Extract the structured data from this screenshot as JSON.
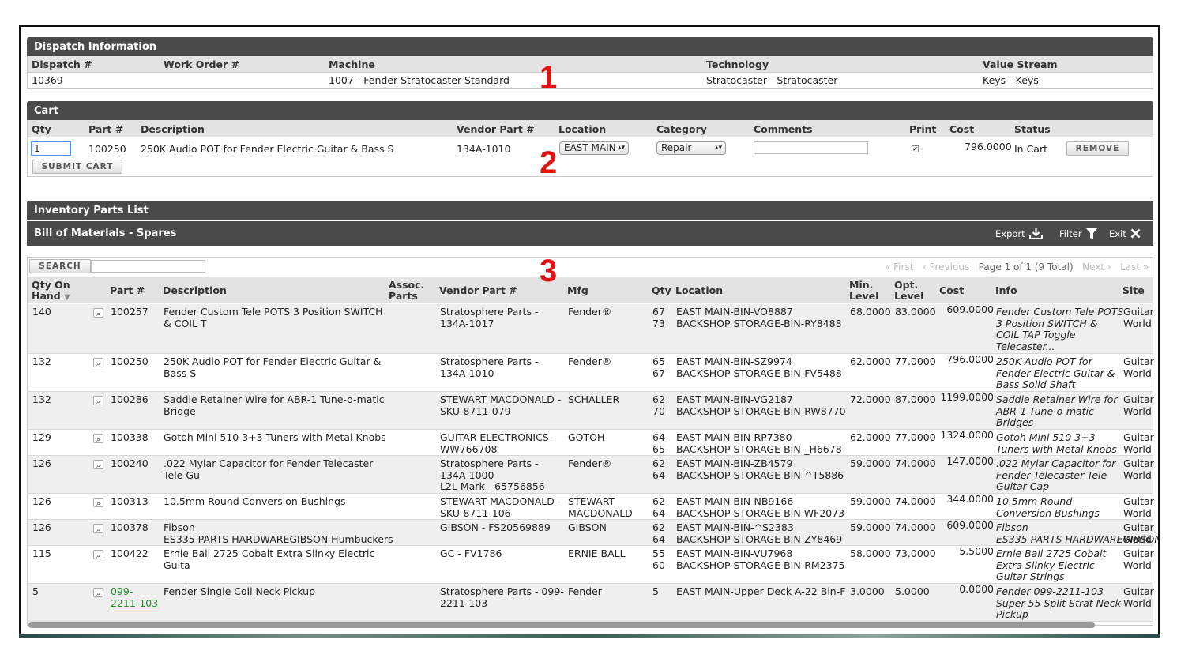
{
  "dispatch": {
    "title": "Dispatch Information",
    "headers": [
      "Dispatch #",
      "Work Order #",
      "Machine",
      "Technology",
      "Value Stream"
    ],
    "values": [
      "10369",
      "",
      "1007 - Fender Stratocaster Standard",
      "Stratocaster - Stratocaster",
      "Keys - Keys"
    ]
  },
  "cart": {
    "title": "Cart",
    "headers": [
      "Qty",
      "Part #",
      "Description",
      "Vendor Part #",
      "Location",
      "Category",
      "Comments",
      "Print",
      "Cost",
      "Status"
    ],
    "row": {
      "qty": "1",
      "part": "100250",
      "description": "250K Audio POT for Fender Electric Guitar & Bass S",
      "vendor_part": "134A-1010",
      "location": "EAST MAIN",
      "category": "Repair",
      "comments": "",
      "print_checked": true,
      "cost": "796.0000",
      "status": "In Cart",
      "remove_label": "REMOVE"
    },
    "submit_label": "SUBMIT CART"
  },
  "inventory": {
    "title": "Inventory Parts List",
    "subtitle": "Bill of Materials - Spares",
    "toolbar": {
      "export": "Export",
      "filter": "Filter",
      "exit": "Exit"
    },
    "search_label": "SEARCH",
    "search_value": "",
    "pager": {
      "first": "« First",
      "previous": "‹ Previous",
      "page": "Page 1 of 1 (9 Total)",
      "next": "Next ›",
      "last": "Last »"
    },
    "columns": [
      "Qty On Hand",
      "Part #",
      "Description",
      "Assoc. Parts",
      "Vendor Part #",
      "Mfg",
      "Qty",
      "Location",
      "Min. Level",
      "Opt. Level",
      "Cost",
      "Info",
      "Site"
    ],
    "rows": [
      {
        "qoh": "140",
        "part": [
          "100257"
        ],
        "desc": [
          "Fender Custom Tele POTS 3 Position SWITCH",
          "& COIL T"
        ],
        "vendor": [
          "Stratosphere Parts -",
          "134A-1017"
        ],
        "mfg": [
          "Fender®"
        ],
        "qty": [
          "67",
          "73"
        ],
        "loc": [
          "EAST MAIN-BIN-VO8887",
          "BACKSHOP STORAGE-BIN-RY8488"
        ],
        "min": "68.0000",
        "opt": "83.0000",
        "cost": "609.0000",
        "info": [
          "Fender Custom Tele POTS",
          "3 Position SWITCH &",
          "COIL TAP Toggle",
          "Telecaster..."
        ],
        "site": [
          "Guitar",
          "World"
        ]
      },
      {
        "qoh": "132",
        "part": [
          "100250"
        ],
        "desc": [
          "250K Audio POT for Fender Electric Guitar &",
          "Bass S"
        ],
        "vendor": [
          "Stratosphere Parts -",
          "134A-1010"
        ],
        "mfg": [
          "Fender®"
        ],
        "qty": [
          "65",
          "67"
        ],
        "loc": [
          "EAST MAIN-BIN-SZ9974",
          "BACKSHOP STORAGE-BIN-FV5488"
        ],
        "min": "62.0000",
        "opt": "77.0000",
        "cost": "796.0000",
        "info": [
          "250K Audio POT for",
          "Fender Electric Guitar &",
          "Bass Solid Shaft"
        ],
        "site": [
          "Guitar",
          "World"
        ]
      },
      {
        "qoh": "132",
        "part": [
          "100286"
        ],
        "desc": [
          "Saddle Retainer Wire for ABR-1 Tune-o-matic",
          "Bridge"
        ],
        "vendor": [
          "STEWART MACDONALD -",
          "SKU-8711-079"
        ],
        "mfg": [
          "SCHALLER"
        ],
        "qty": [
          "62",
          "70"
        ],
        "loc": [
          "EAST MAIN-BIN-VG2187",
          "BACKSHOP STORAGE-BIN-RW8770"
        ],
        "min": "72.0000",
        "opt": "87.0000",
        "cost": "1199.0000",
        "info": [
          "Saddle Retainer Wire for",
          "ABR-1 Tune-o-matic",
          "Bridges"
        ],
        "site": [
          "Guitar",
          "World"
        ]
      },
      {
        "qoh": "129",
        "part": [
          "100338"
        ],
        "desc": [
          "Gotoh Mini 510 3+3 Tuners with Metal Knobs"
        ],
        "vendor": [
          "GUITAR ELECTRONICS -",
          "WW766708"
        ],
        "mfg": [
          "GOTOH"
        ],
        "qty": [
          "64",
          "65"
        ],
        "loc": [
          "EAST MAIN-BIN-RP7380",
          "BACKSHOP STORAGE-BIN-_H6678"
        ],
        "min": "62.0000",
        "opt": "77.0000",
        "cost": "1324.0000",
        "info": [
          "Gotoh Mini 510 3+3",
          "Tuners with Metal Knobs"
        ],
        "site": [
          "Guitar",
          "World"
        ]
      },
      {
        "qoh": "126",
        "part": [
          "100240"
        ],
        "desc": [
          ".022 Mylar Capacitor for Fender Telecaster",
          "Tele Gu"
        ],
        "vendor": [
          "Stratosphere Parts -",
          "134A-1000",
          "L2L Mark - 65756856"
        ],
        "mfg": [
          "Fender®"
        ],
        "qty": [
          "62",
          "64"
        ],
        "loc": [
          "EAST MAIN-BIN-ZB4579",
          "BACKSHOP STORAGE-BIN-^T5886"
        ],
        "min": "59.0000",
        "opt": "74.0000",
        "cost": "147.0000",
        "info": [
          ".022 Mylar Capacitor for",
          "Fender Telecaster Tele",
          "Guitar Cap"
        ],
        "site": [
          "Guitar",
          "World"
        ]
      },
      {
        "qoh": "126",
        "part": [
          "100313"
        ],
        "desc": [
          "10.5mm Round Conversion Bushings"
        ],
        "vendor": [
          "STEWART MACDONALD -",
          "SKU-8711-106"
        ],
        "mfg": [
          "STEWART",
          "MACDONALD"
        ],
        "qty": [
          "62",
          "64"
        ],
        "loc": [
          "EAST MAIN-BIN-NB9166",
          "BACKSHOP STORAGE-BIN-WF2073"
        ],
        "min": "59.0000",
        "opt": "74.0000",
        "cost": "344.0000",
        "info": [
          "10.5mm Round",
          "Conversion Bushings"
        ],
        "site": [
          "Guitar",
          "World"
        ]
      },
      {
        "qoh": "126",
        "part": [
          "100378"
        ],
        "desc": [
          "Fibson",
          "ES335 PARTS HARDWAREGIBSON Humbuckers"
        ],
        "vendor": [
          "GIBSON - FS20569889"
        ],
        "mfg": [
          "GIBSON"
        ],
        "qty": [
          "62",
          "64"
        ],
        "loc": [
          "EAST MAIN-BIN-^S2383",
          "BACKSHOP STORAGE-BIN-ZY8469"
        ],
        "min": "59.0000",
        "opt": "74.0000",
        "cost": "609.0000",
        "info": [
          "Fibson",
          "ES335 PARTS HARDWAREGIBSON"
        ],
        "site": [
          "Guitar",
          "World"
        ]
      },
      {
        "qoh": "115",
        "part": [
          "100422"
        ],
        "desc": [
          "Ernie Ball 2725 Cobalt Extra Slinky Electric",
          "Guita"
        ],
        "vendor": [
          "GC - FV1786"
        ],
        "mfg": [
          "ERNIE BALL"
        ],
        "qty": [
          "55",
          "60"
        ],
        "loc": [
          "EAST MAIN-BIN-VU7968",
          "BACKSHOP STORAGE-BIN-RM2375"
        ],
        "min": "58.0000",
        "opt": "73.0000",
        "cost": "5.5000",
        "info": [
          "Ernie Ball 2725 Cobalt",
          "Extra Slinky Electric",
          "Guitar Strings"
        ],
        "site": [
          "Guitar",
          "World"
        ]
      },
      {
        "qoh": "5",
        "part": [
          "099-",
          "2211-103"
        ],
        "part_link": true,
        "desc": [
          "Fender Single Coil Neck Pickup"
        ],
        "vendor": [
          "Stratosphere Parts - 099-",
          "2211-103"
        ],
        "mfg": [
          "Fender"
        ],
        "qty": [
          "5"
        ],
        "loc": [
          "EAST MAIN-Upper Deck A-22 Bin-F"
        ],
        "min": "3.0000",
        "opt": "5.0000",
        "cost": "0.0000",
        "info": [
          "Fender 099-2211-103",
          "Super 55 Split Strat Neck",
          "Pickup"
        ],
        "site": [
          "Guitar",
          "World"
        ]
      }
    ]
  },
  "annotations": [
    "1",
    "2",
    "3"
  ],
  "colors": {
    "panel_bar": "#4a4a4a",
    "annotation": "#e01313",
    "link": "#1f8a2a",
    "focus": "#4d90fe"
  },
  "icons": {
    "export": "download-icon",
    "filter": "funnel-icon",
    "exit": "close-icon",
    "detail": "magnifier-icon"
  }
}
